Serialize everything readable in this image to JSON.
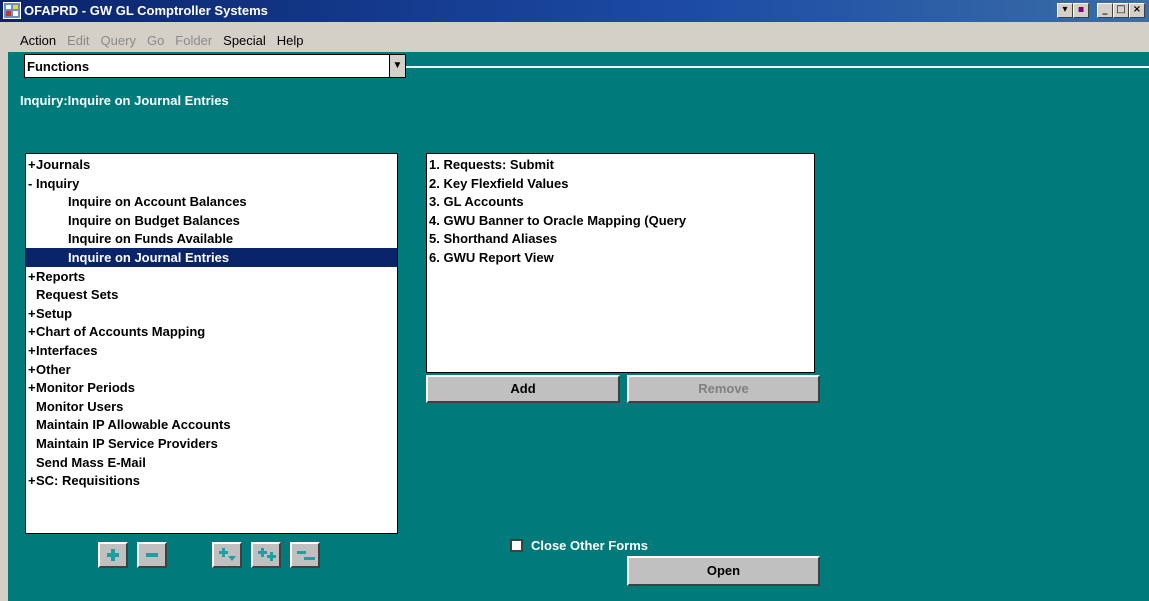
{
  "window": {
    "title": "OFAPRD - GW GL Comptroller Systems",
    "controls": [
      "_",
      "□",
      "×"
    ]
  },
  "menu": {
    "items": [
      {
        "label": "Action",
        "enabled": true
      },
      {
        "label": "Edit",
        "enabled": false
      },
      {
        "label": "Query",
        "enabled": false
      },
      {
        "label": "Go",
        "enabled": false
      },
      {
        "label": "Folder",
        "enabled": false
      },
      {
        "label": "Special",
        "enabled": true
      },
      {
        "label": "Help",
        "enabled": true
      }
    ]
  },
  "selector": {
    "value": "Functions"
  },
  "subtitle": "Inquiry:Inquire on Journal Entries",
  "tree": {
    "items": [
      {
        "label": "Journals",
        "expander": "+",
        "level": 0
      },
      {
        "label": "Inquiry",
        "expander": "-",
        "level": 0
      },
      {
        "label": "Inquire on Account Balances",
        "expander": "",
        "level": 2
      },
      {
        "label": "Inquire on Budget Balances",
        "expander": "",
        "level": 2
      },
      {
        "label": "Inquire on Funds Available",
        "expander": "",
        "level": 2
      },
      {
        "label": "Inquire on Journal Entries",
        "expander": "",
        "level": 2,
        "selected": true
      },
      {
        "label": "Reports",
        "expander": "+",
        "level": 0
      },
      {
        "label": "Request Sets",
        "expander": "",
        "level": 1
      },
      {
        "label": "Setup",
        "expander": "+",
        "level": 0
      },
      {
        "label": "Chart of Accounts Mapping",
        "expander": "+",
        "level": 0
      },
      {
        "label": "Interfaces",
        "expander": "+",
        "level": 0
      },
      {
        "label": "Other",
        "expander": "+",
        "level": 0
      },
      {
        "label": "Monitor Periods",
        "expander": "+",
        "level": 0
      },
      {
        "label": "Monitor Users",
        "expander": "",
        "level": 1
      },
      {
        "label": "Maintain IP Allowable Accounts",
        "expander": "",
        "level": 1
      },
      {
        "label": "Maintain IP Service Providers",
        "expander": "",
        "level": 1
      },
      {
        "label": "Send Mass E-Mail",
        "expander": "",
        "level": 1
      },
      {
        "label": "SC: Requisitions",
        "expander": "+",
        "level": 0
      }
    ]
  },
  "top_ten": {
    "items": [
      "1. Requests: Submit",
      "2. Key Flexfield Values",
      "3. GL Accounts",
      "4. GWU Banner to Oracle Mapping (Query",
      "5. Shorthand Aliases",
      "6. GWU Report View"
    ]
  },
  "buttons": {
    "add": "Add",
    "remove": "Remove",
    "open": "Open"
  },
  "close_other_forms": {
    "label": "Close Other Forms",
    "checked": false
  },
  "colors": {
    "background": "#007a7a",
    "selection": "#0a246a",
    "titlebar": "#0a246a"
  }
}
